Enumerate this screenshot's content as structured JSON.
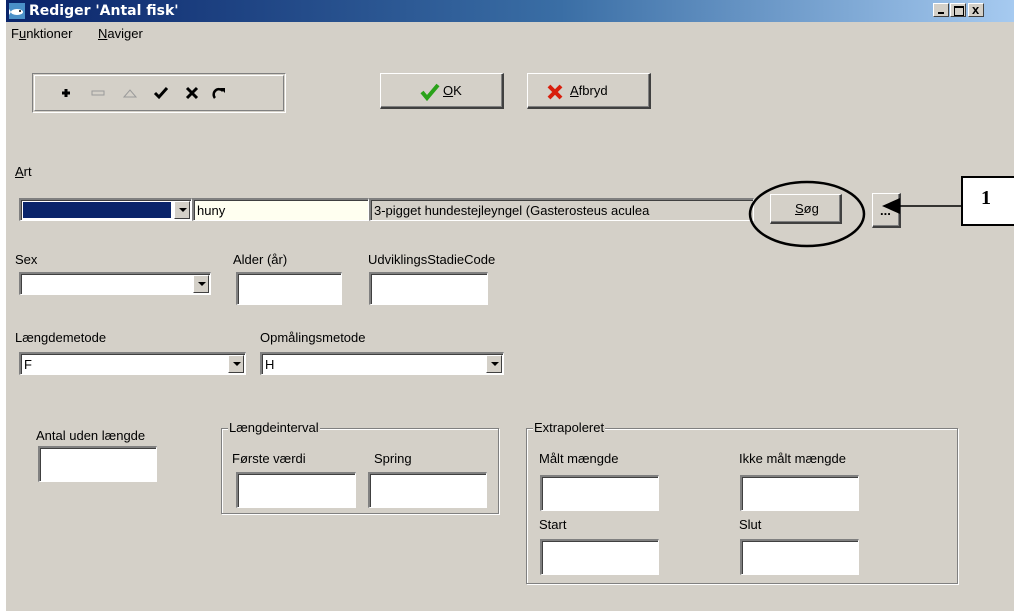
{
  "window": {
    "title": "Rediger 'Antal fisk'"
  },
  "menu": [
    {
      "prefix": "F",
      "accel": "u",
      "rest": "nktioner"
    },
    {
      "prefix": "",
      "accel": "N",
      "rest": "aviger"
    }
  ],
  "toolbar": {
    "icons": [
      "plus-icon",
      "minus-icon",
      "triangle-up-icon",
      "check-icon",
      "x-icon",
      "refresh-icon"
    ]
  },
  "buttons": {
    "ok": {
      "accel": "O",
      "rest": "K"
    },
    "cancel": {
      "accel": "A",
      "rest": "fbryd"
    },
    "search": {
      "accel": "S",
      "rest": "øg"
    },
    "more": "..."
  },
  "art": {
    "label_accel": "A",
    "label_rest": "rt",
    "code_value": "huny",
    "name_value": "3-pigget hundestejleyngel (Gasterosteus aculea"
  },
  "fields": {
    "sex_label": "Sex",
    "alder_label": "Alder (år)",
    "stadie_label": "UdviklingsStadieCode",
    "laengdemetode_label": "Længdemetode",
    "laengdemetode_value": "F",
    "opmaalingsmetode_label": "Opmålingsmetode",
    "opmaalingsmetode_value": "H",
    "antal_label": "Antal uden længde"
  },
  "laengdeinterval": {
    "legend": "Længdeinterval",
    "foerste_label": "Første værdi",
    "spring_label": "Spring"
  },
  "extrapoleret": {
    "legend": "Extrapoleret",
    "maalt_label": "Målt mængde",
    "ikke_maalt_label": "Ikke målt mængde",
    "start_label": "Start",
    "slut_label": "Slut"
  },
  "annotation": {
    "number": "1"
  },
  "colors": {
    "title_start": "#0a246a",
    "title_end": "#a6caf0",
    "face": "#d4d0c8",
    "selected": "#0a246a",
    "code_bg": "#fffff0"
  }
}
